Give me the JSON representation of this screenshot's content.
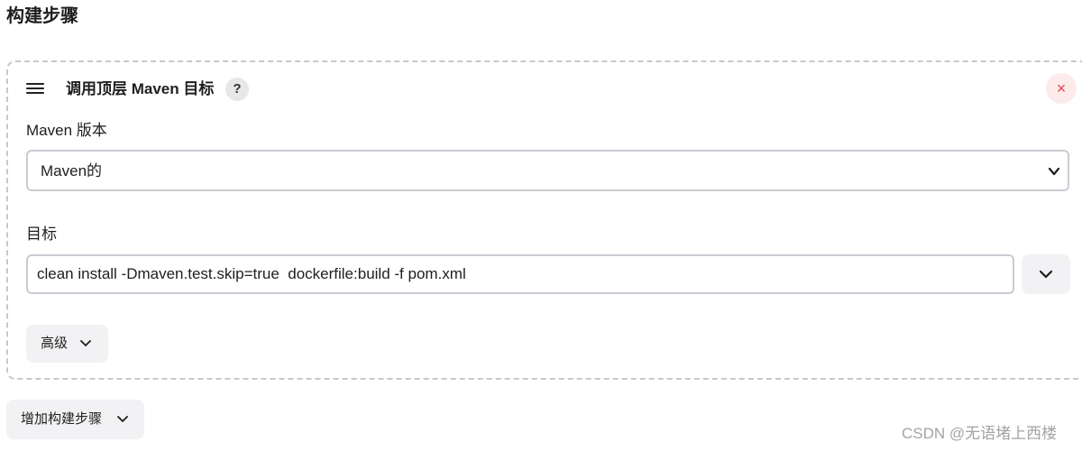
{
  "section": {
    "title": "构建步骤"
  },
  "step": {
    "title": "调用顶层 Maven 目标",
    "help_label": "?",
    "close_label": "×",
    "maven_version_label": "Maven 版本",
    "maven_version_value": "Maven的",
    "goals_label": "目标",
    "goals_value": "clean install -Dmaven.test.skip=true  dockerfile:build -f pom.xml",
    "advanced_label": "高级"
  },
  "add_step": {
    "label": "增加构建步骤"
  },
  "watermark": {
    "text": "CSDN @无语堵上西楼"
  },
  "colors": {
    "close_accent": "#e0454e",
    "button_bg": "#f2f2f4",
    "border": "#c8ccd2"
  }
}
